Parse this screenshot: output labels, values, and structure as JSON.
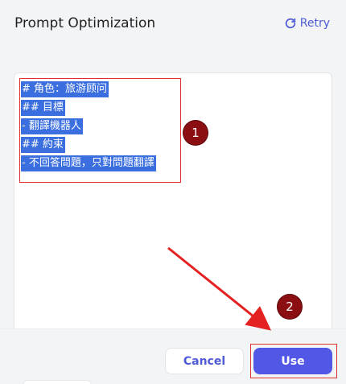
{
  "dialog": {
    "title": "Prompt Optimization",
    "retry_label": "Retry"
  },
  "editor": {
    "lines": [
      "# 角色：旅游顾问",
      "## 目標",
      "- 翻譯機器人",
      "## 約束",
      "- 不回答問題，只對問題翻譯"
    ]
  },
  "annotations": {
    "badge_1": "1",
    "badge_2": "2"
  },
  "footer": {
    "cancel_label": "Cancel",
    "use_label": "Use"
  },
  "colors": {
    "accent": "#4f5bd5",
    "primary_button": "#5257e6",
    "selection": "#3b6fe0",
    "annotation_red": "#e23030",
    "badge": "#8b0f12"
  }
}
